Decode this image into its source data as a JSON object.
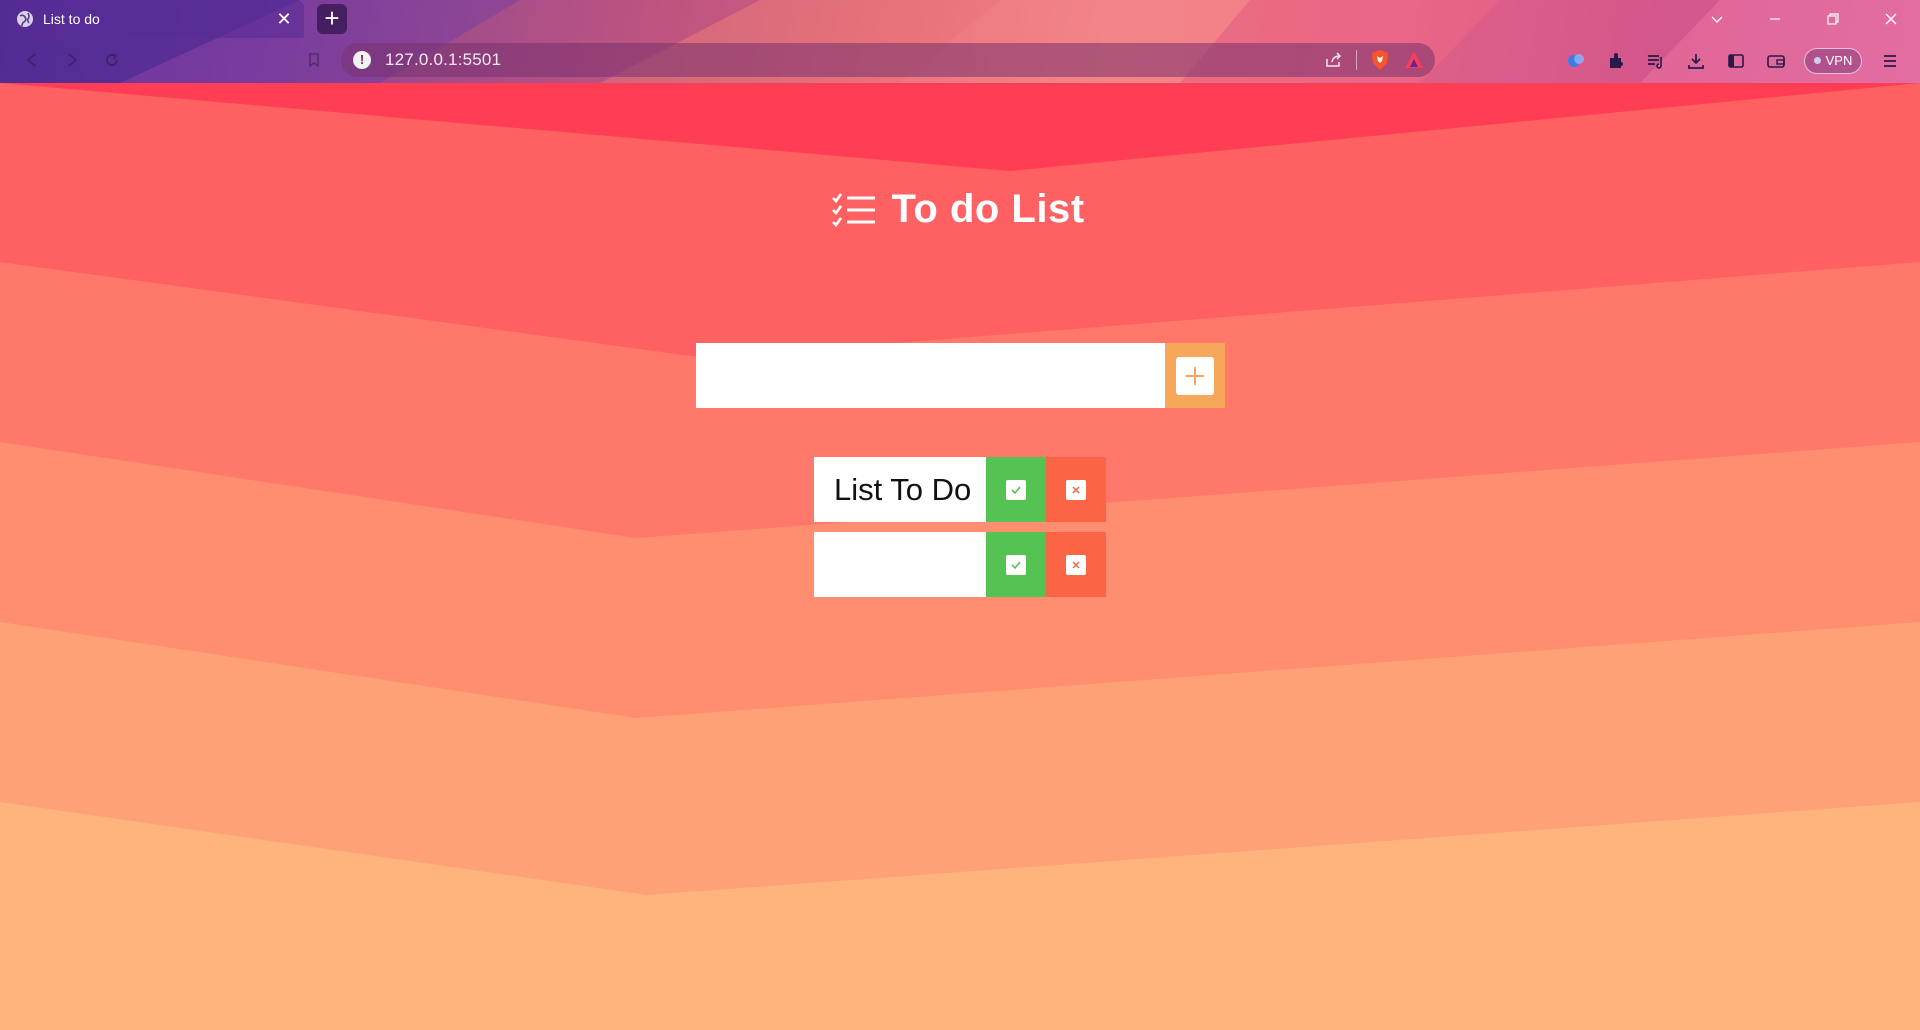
{
  "browser": {
    "tab": {
      "title": "List to do",
      "close_label": "✕"
    },
    "new_tab_label": "+",
    "address": {
      "url": "127.0.0.1:5501",
      "info_label": "!"
    },
    "vpn_label": "VPN"
  },
  "page": {
    "title": "To do List",
    "input": {
      "value": "",
      "placeholder": ""
    },
    "items": [
      {
        "text": "List To Do"
      },
      {
        "text": ""
      }
    ]
  },
  "colors": {
    "add_button": "#f6a75a",
    "check_button": "#54c352",
    "delete_button": "#fb6445",
    "page_top": "#ff3b52",
    "page_bottom": "#ffb27a"
  }
}
